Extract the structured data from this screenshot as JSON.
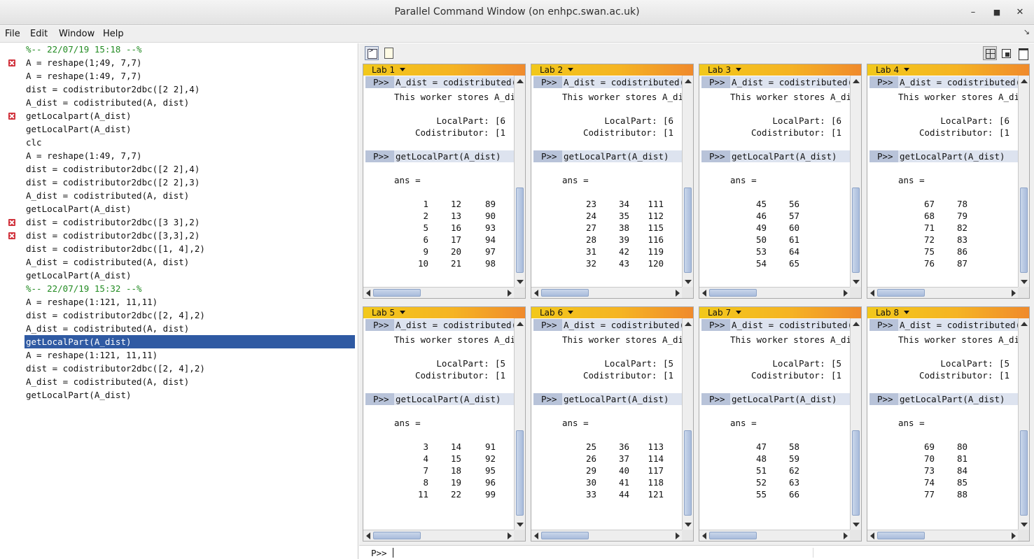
{
  "window": {
    "title": "Parallel Command Window (on enhpc.swan.ac.uk)",
    "minimize": "–",
    "maximize": "■",
    "close": "✕"
  },
  "menu": [
    "File",
    "Edit",
    "Window",
    "Help"
  ],
  "history": [
    {
      "text": "%-- 22/07/19 15:18 --%",
      "type": "stamp"
    },
    {
      "text": "A = reshape(1;49, 7,7)",
      "error": true
    },
    {
      "text": "A = reshape(1:49, 7,7)"
    },
    {
      "text": "dist = codistributor2dbc([2 2],4)"
    },
    {
      "text": "A_dist = codistributed(A, dist)"
    },
    {
      "text": "getLocalpart(A_dist)",
      "error": true
    },
    {
      "text": "getLocalPart(A_dist)"
    },
    {
      "text": "clc"
    },
    {
      "text": "A = reshape(1:49, 7,7)"
    },
    {
      "text": "dist = codistributor2dbc([2 2],4)"
    },
    {
      "text": "dist = codistributor2dbc([2 2],3)"
    },
    {
      "text": "A_dist = codistributed(A, dist)"
    },
    {
      "text": "getLocalPart(A_dist)"
    },
    {
      "text": "dist = codistributor2dbc([3 3],2)",
      "error": true
    },
    {
      "text": "dist = codistributor2dbc([3,3],2)",
      "error": true
    },
    {
      "text": "dist = codistributor2dbc([1, 4],2)"
    },
    {
      "text": "A_dist = codistributed(A, dist)"
    },
    {
      "text": "getLocalPart(A_dist)"
    },
    {
      "text": "%-- 22/07/19 15:32 --%",
      "type": "stamp"
    },
    {
      "text": "A = reshape(1:121, 11,11)"
    },
    {
      "text": "dist = codistributor2dbc([2, 4],2)"
    },
    {
      "text": "A_dist = codistributed(A, dist)"
    },
    {
      "text": "getLocalPart(A_dist)",
      "selected": true
    },
    {
      "text": "A = reshape(1:121, 11,11)"
    },
    {
      "text": "dist = codistributor2dbc([2, 4],2)"
    },
    {
      "text": "A_dist = codistributed(A, dist)"
    },
    {
      "text": "getLocalPart(A_dist)"
    }
  ],
  "labs": [
    {
      "name": "Lab 1",
      "local_part": "[6",
      "codist": "[1",
      "rows": [
        [
          "1",
          "12",
          "89"
        ],
        [
          "2",
          "13",
          "90"
        ],
        [
          "5",
          "16",
          "93"
        ],
        [
          "6",
          "17",
          "94"
        ],
        [
          "9",
          "20",
          "97"
        ],
        [
          "10",
          "21",
          "98"
        ]
      ]
    },
    {
      "name": "Lab 2",
      "local_part": "[6",
      "codist": "[1",
      "rows": [
        [
          "23",
          "34",
          "111"
        ],
        [
          "24",
          "35",
          "112"
        ],
        [
          "27",
          "38",
          "115"
        ],
        [
          "28",
          "39",
          "116"
        ],
        [
          "31",
          "42",
          "119"
        ],
        [
          "32",
          "43",
          "120"
        ]
      ]
    },
    {
      "name": "Lab 3",
      "local_part": "[6",
      "codist": "[1",
      "rows": [
        [
          "45",
          "56"
        ],
        [
          "46",
          "57"
        ],
        [
          "49",
          "60"
        ],
        [
          "50",
          "61"
        ],
        [
          "53",
          "64"
        ],
        [
          "54",
          "65"
        ]
      ]
    },
    {
      "name": "Lab 4",
      "local_part": "[6",
      "codist": "[1",
      "rows": [
        [
          "67",
          "78"
        ],
        [
          "68",
          "79"
        ],
        [
          "71",
          "82"
        ],
        [
          "72",
          "83"
        ],
        [
          "75",
          "86"
        ],
        [
          "76",
          "87"
        ]
      ]
    },
    {
      "name": "Lab 5",
      "local_part": "[5",
      "codist": "[1",
      "rows": [
        [
          "3",
          "14",
          "91"
        ],
        [
          "4",
          "15",
          "92"
        ],
        [
          "7",
          "18",
          "95"
        ],
        [
          "8",
          "19",
          "96"
        ],
        [
          "11",
          "22",
          "99"
        ]
      ]
    },
    {
      "name": "Lab 6",
      "local_part": "[5",
      "codist": "[1",
      "rows": [
        [
          "25",
          "36",
          "113"
        ],
        [
          "26",
          "37",
          "114"
        ],
        [
          "29",
          "40",
          "117"
        ],
        [
          "30",
          "41",
          "118"
        ],
        [
          "33",
          "44",
          "121"
        ]
      ]
    },
    {
      "name": "Lab 7",
      "local_part": "[5",
      "codist": "[1",
      "rows": [
        [
          "47",
          "58"
        ],
        [
          "48",
          "59"
        ],
        [
          "51",
          "62"
        ],
        [
          "52",
          "63"
        ],
        [
          "55",
          "66"
        ]
      ]
    },
    {
      "name": "Lab 8",
      "local_part": "[5",
      "codist": "[1",
      "rows": [
        [
          "69",
          "80"
        ],
        [
          "70",
          "81"
        ],
        [
          "73",
          "84"
        ],
        [
          "74",
          "85"
        ],
        [
          "77",
          "88"
        ]
      ]
    }
  ],
  "lab_common": {
    "prompt": "P>>",
    "cmd1": "A_dist = codistributed(A, dist)",
    "stores": "This worker stores A_dist(",
    "local_label": "LocalPart: ",
    "codist_label": "Codistributor: ",
    "cmd2": "getLocalPart(A_dist)",
    "ans": "ans ="
  },
  "command_prompt": "P>>",
  "colors": {
    "selection": "#2f5aa3",
    "timestamp": "#228b22",
    "error": "#d0303a",
    "lab_header_start": "#f2c81b",
    "lab_header_end": "#f08a2c",
    "prompt_bg": "#b8c3d9"
  }
}
